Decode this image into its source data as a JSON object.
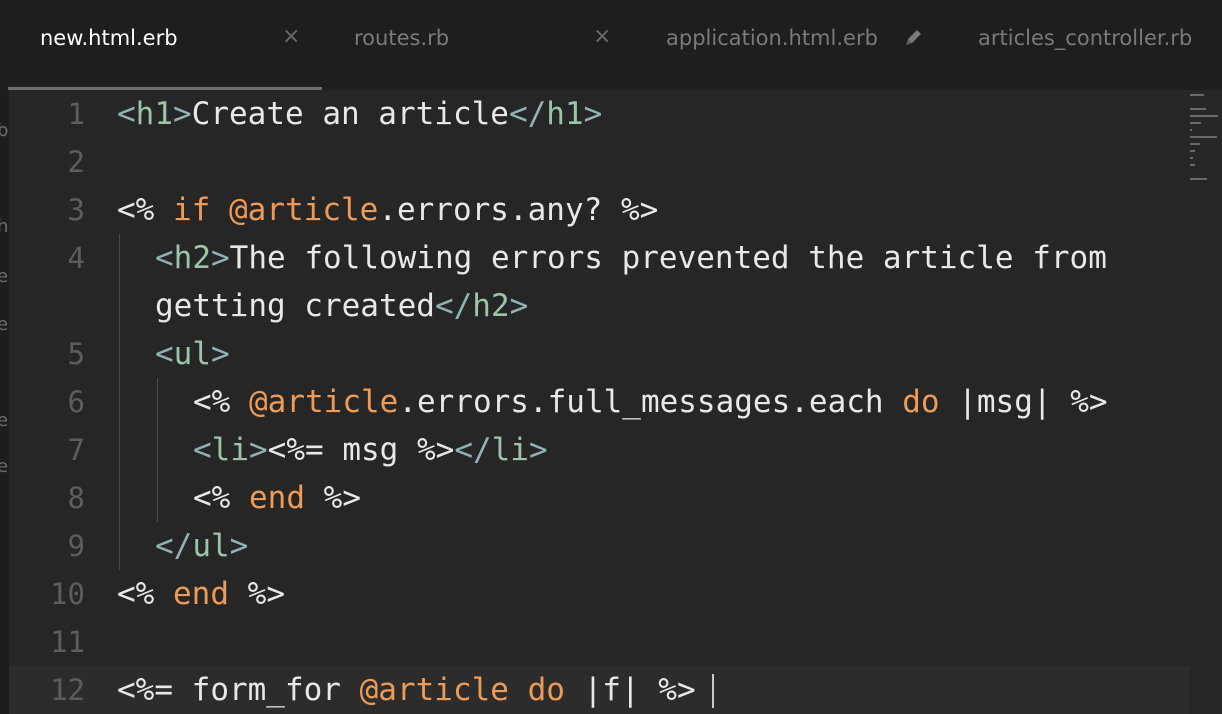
{
  "tabs": [
    {
      "label": "new.html.erb",
      "active": true,
      "close": "×"
    },
    {
      "label": "routes.rb",
      "active": false,
      "close": "×"
    },
    {
      "label": "application.html.erb",
      "active": false,
      "icon": "pencil-icon"
    },
    {
      "label": "articles_controller.rb",
      "active": false
    }
  ],
  "left_edge_glyphs": [
    "b",
    "h",
    "e",
    "e",
    "e",
    "e"
  ],
  "editor": {
    "line_numbers": [
      "1",
      "2",
      "3",
      "4",
      "5",
      "6",
      "7",
      "8",
      "9",
      "10",
      "11",
      "12"
    ],
    "lines": [
      [
        [
          "<",
          "br"
        ],
        [
          "h1",
          "tag"
        ],
        [
          ">",
          "br"
        ],
        [
          "Create an article",
          "txt"
        ],
        [
          "</",
          "br"
        ],
        [
          "h1",
          "tag"
        ],
        [
          ">",
          "br"
        ]
      ],
      [],
      [
        [
          "<% ",
          "erb"
        ],
        [
          "if",
          "kw"
        ],
        [
          " ",
          "txt"
        ],
        [
          "@article",
          "ivar"
        ],
        [
          ".errors.any? ",
          "txt"
        ],
        [
          "%>",
          "erb"
        ]
      ],
      [
        [
          "<",
          "br"
        ],
        [
          "h2",
          "tag"
        ],
        [
          ">",
          "br"
        ],
        [
          "The following errors prevented the article from",
          "txt"
        ]
      ],
      [
        [
          "getting created",
          "txt"
        ],
        [
          "</",
          "br"
        ],
        [
          "h2",
          "tag"
        ],
        [
          ">",
          "br"
        ]
      ],
      [
        [
          "<",
          "br"
        ],
        [
          "ul",
          "tag"
        ],
        [
          ">",
          "br"
        ]
      ],
      [
        [
          "<% ",
          "erb"
        ],
        [
          "@article",
          "ivar"
        ],
        [
          ".errors.full_messages.each ",
          "txt"
        ],
        [
          "do",
          "kw"
        ],
        [
          " |msg| ",
          "txt"
        ],
        [
          "%>",
          "erb"
        ]
      ],
      [
        [
          "<",
          "br"
        ],
        [
          "li",
          "tag"
        ],
        [
          ">",
          "br"
        ],
        [
          "<%= msg %>",
          "erb"
        ],
        [
          "</",
          "br"
        ],
        [
          "li",
          "tag"
        ],
        [
          ">",
          "br"
        ]
      ],
      [
        [
          "<% ",
          "erb"
        ],
        [
          "end",
          "kw"
        ],
        [
          " %>",
          "erb"
        ]
      ],
      [
        [
          "</",
          "br"
        ],
        [
          "ul",
          "tag"
        ],
        [
          ">",
          "br"
        ]
      ],
      [
        [
          "<% ",
          "erb"
        ],
        [
          "end",
          "kw"
        ],
        [
          " %>",
          "erb"
        ]
      ],
      [],
      [
        [
          "<%= ",
          "erb"
        ],
        [
          "form_for ",
          "txt"
        ],
        [
          "@article",
          "ivar"
        ],
        [
          " ",
          "txt"
        ],
        [
          "do",
          "kw"
        ],
        [
          " |f| ",
          "txt"
        ],
        [
          "%>",
          "erb"
        ]
      ]
    ],
    "current_line": 12
  },
  "colors": {
    "background": "#262626",
    "tag": "#9cc4a8",
    "keyword": "#ef9b56",
    "text": "#e8e8e8",
    "line_number": "#5d5d5d"
  }
}
